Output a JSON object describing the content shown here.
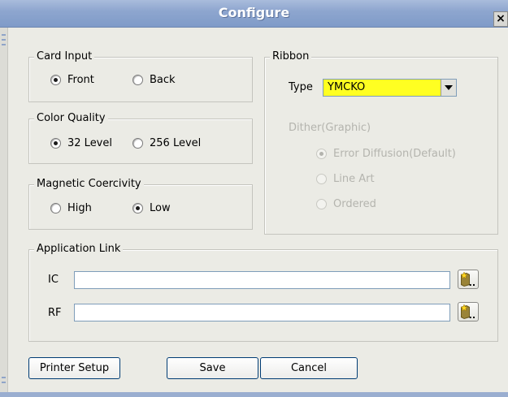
{
  "window": {
    "title": "Configure",
    "close_label": "×"
  },
  "card_input": {
    "label": "Card Input",
    "options": [
      {
        "label": "Front",
        "selected": true
      },
      {
        "label": "Back",
        "selected": false
      }
    ]
  },
  "color_quality": {
    "label": "Color Quality",
    "options": [
      {
        "label": "32 Level",
        "selected": true
      },
      {
        "label": "256 Level",
        "selected": false
      }
    ]
  },
  "magnetic_coercivity": {
    "label": "Magnetic Coercivity",
    "options": [
      {
        "label": "High",
        "selected": false
      },
      {
        "label": "Low",
        "selected": true
      }
    ]
  },
  "ribbon": {
    "label": "Ribbon",
    "type_label": "Type",
    "type_value": "YMCKO",
    "type_bg_color": "#ffff22",
    "dither_label": "Dither(Graphic)",
    "dither_options": [
      {
        "label": "Error Diffusion(Default)",
        "selected": true
      },
      {
        "label": "Line Art",
        "selected": false
      },
      {
        "label": "Ordered",
        "selected": false
      }
    ]
  },
  "application_link": {
    "label": "Application Link",
    "ic": {
      "label": "IC",
      "value": ""
    },
    "rf": {
      "label": "RF",
      "value": ""
    },
    "browse_label": ".."
  },
  "buttons": {
    "printer_setup": "Printer Setup",
    "save": "Save",
    "cancel": "Cancel"
  }
}
